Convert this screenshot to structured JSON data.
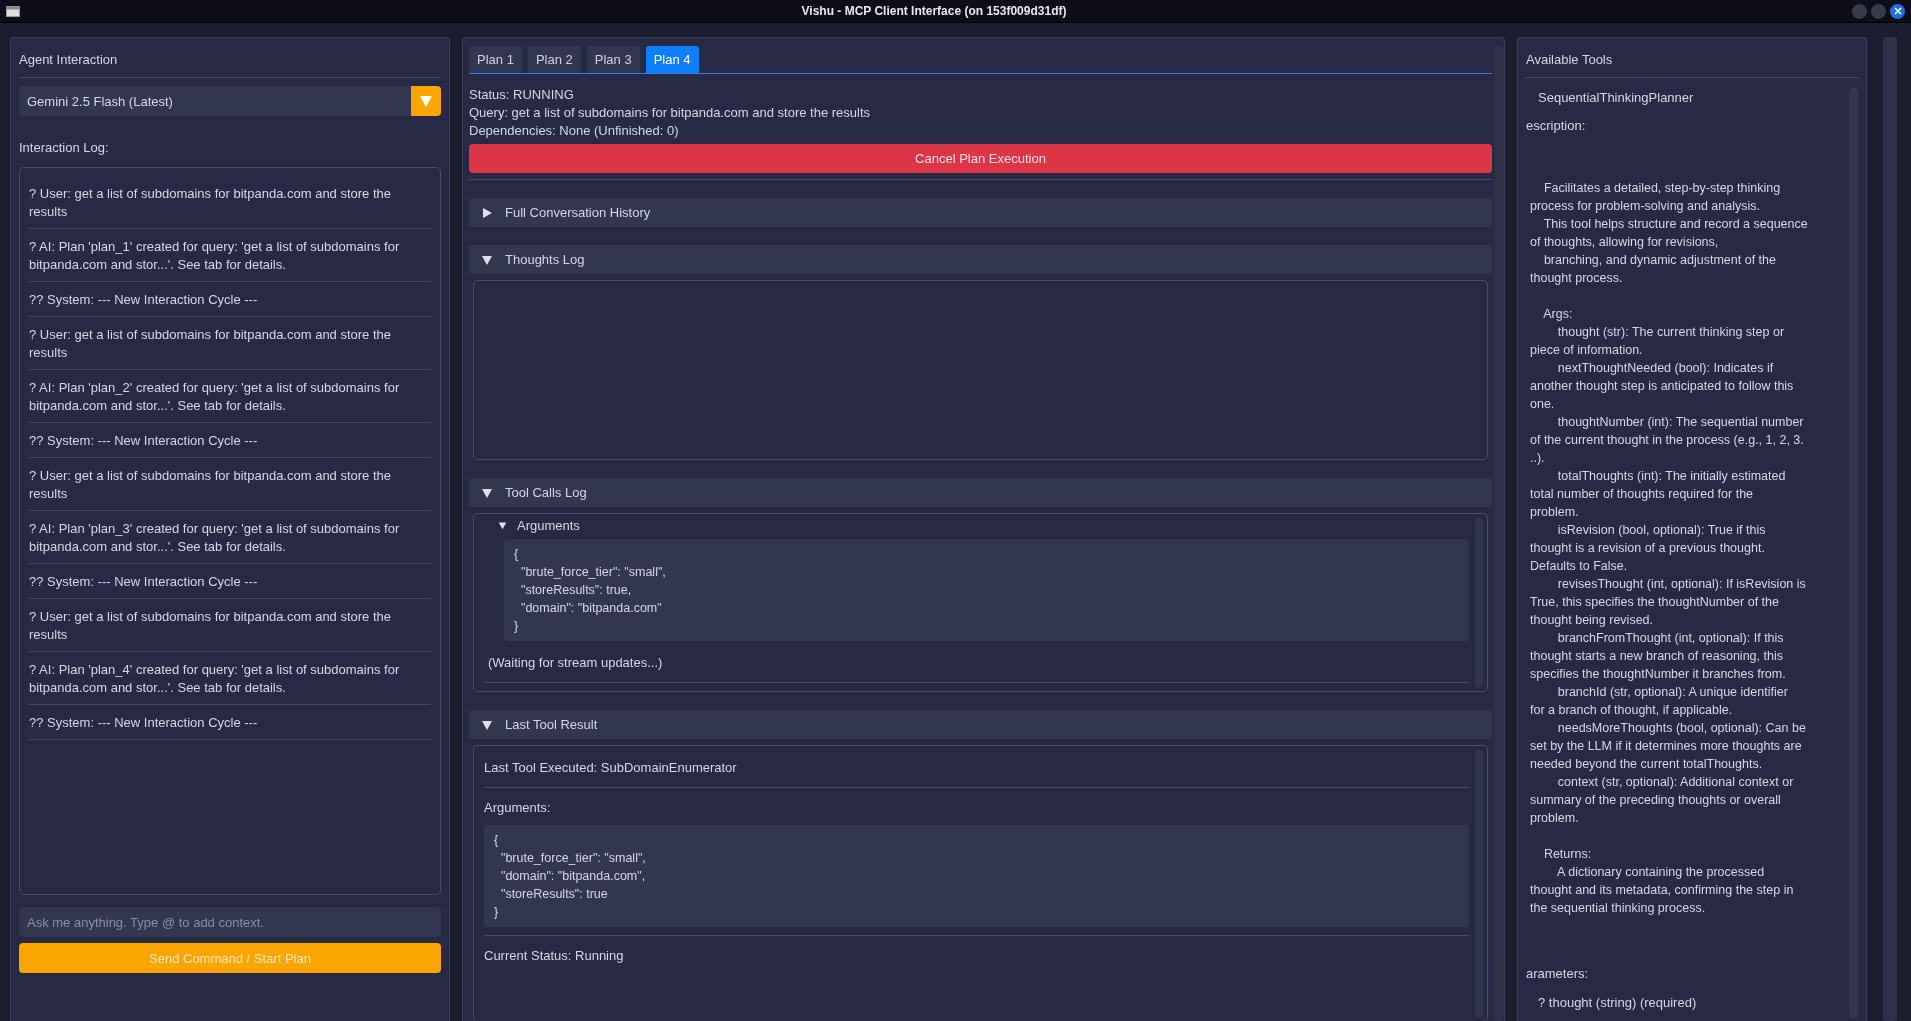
{
  "window": {
    "title": "Vishu - MCP Client Interface (on 153f009d31df)"
  },
  "agent_panel": {
    "title": "Agent Interaction",
    "model_select": {
      "value": "Gemini 2.5 Flash (Latest)"
    },
    "log_label": "Interaction Log:",
    "log": [
      "? User: get a list of subdomains for bitpanda.com and store the results",
      "? AI: Plan 'plan_1' created for query: 'get a list of subdomains for bitpanda.com and stor...'. See tab for details.",
      "?? System: --- New Interaction Cycle ---",
      "? User: get a list of subdomains for bitpanda.com and store the results",
      "? AI: Plan 'plan_2' created for query: 'get a list of subdomains for bitpanda.com and stor...'. See tab for details.",
      "?? System: --- New Interaction Cycle ---",
      "? User: get a list of subdomains for bitpanda.com and store the results",
      "? AI: Plan 'plan_3' created for query: 'get a list of subdomains for bitpanda.com and stor...'. See tab for details.",
      "?? System: --- New Interaction Cycle ---",
      "? User: get a list of subdomains for bitpanda.com and store the results",
      "? AI: Plan 'plan_4' created for query: 'get a list of subdomains for bitpanda.com and stor...'. See tab for details.",
      "?? System: --- New Interaction Cycle ---"
    ],
    "input": {
      "placeholder": "Ask me anything. Type @ to add context."
    },
    "send_button": "Send Command / Start Plan"
  },
  "plan_panel": {
    "tabs": [
      {
        "label": "Plan 1",
        "selected": false
      },
      {
        "label": "Plan 2",
        "selected": false
      },
      {
        "label": "Plan 3",
        "selected": false
      },
      {
        "label": "Plan 4",
        "selected": true
      }
    ],
    "status": "Status: RUNNING",
    "query": "Query: get a list of subdomains for bitpanda.com and store the results",
    "dependencies": "Dependencies: None (Unfinished: 0)",
    "cancel_button": "Cancel Plan Execution",
    "sections": [
      {
        "kind": "history",
        "title": "Full Conversation History",
        "expanded": false
      },
      {
        "kind": "thoughts",
        "title": "Thoughts Log",
        "expanded": true
      },
      {
        "kind": "tool_calls",
        "title": "Tool Calls Log",
        "expanded": true,
        "arguments_label": "Arguments",
        "arguments_expanded": true,
        "code": "{\n  \"brute_force_tier\": \"small\",\n  \"storeResults\": true,\n  \"domain\": \"bitpanda.com\"\n}",
        "note": "(Waiting for stream updates...)"
      },
      {
        "kind": "result",
        "title": "Last Tool Result",
        "expanded": true,
        "executed": "Last Tool Executed: SubDomainEnumerator",
        "arguments_label": "Arguments:",
        "code": "{\n  \"brute_force_tier\": \"small\",\n  \"domain\": \"bitpanda.com\",\n  \"storeResults\": true\n}",
        "status": "Current Status: Running"
      }
    ]
  },
  "tools_panel": {
    "title": "Available Tools",
    "tool_name": "SequentialThinkingPlanner",
    "description_label": "escription:",
    "description": "    Facilitates a detailed, step-by-step thinking\nprocess for problem-solving and analysis.\n    This tool helps structure and record a sequence\nof thoughts, allowing for revisions,\n    branching, and dynamic adjustment of the\nthought process.\n\n    Args:\n        thought (str): The current thinking step or\npiece of information.\n        nextThoughtNeeded (bool): Indicates if\nanother thought step is anticipated to follow this\none.\n        thoughtNumber (int): The sequential number\nof the current thought in the process (e.g., 1, 2, 3.\n..).\n        totalThoughts (int): The initially estimated\ntotal number of thoughts required for the\nproblem.\n        isRevision (bool, optional): True if this\nthought is a revision of a previous thought.\nDefaults to False.\n        revisesThought (int, optional): If isRevision is\nTrue, this specifies the thoughtNumber of the\nthought being revised.\n        branchFromThought (int, optional): If this\nthought starts a new branch of reasoning, this\nspecifies the thoughtNumber it branches from.\n        branchId (str, optional): A unique identifier\nfor a branch of thought, if applicable.\n        needsMoreThoughts (bool, optional): Can be\nset by the LLM if it determines more thoughts are\nneeded beyond the current totalThoughts.\n        context (str, optional): Additional context or\nsummary of the preceding thoughts or overall\nproblem.\n\n    Returns:\n        A dictionary containing the processed\nthought and its metadata, confirming the step in\nthe sequential thinking process.",
    "parameters_label": "arameters:",
    "parameters": [
      "? thought (string) (required)"
    ]
  }
}
